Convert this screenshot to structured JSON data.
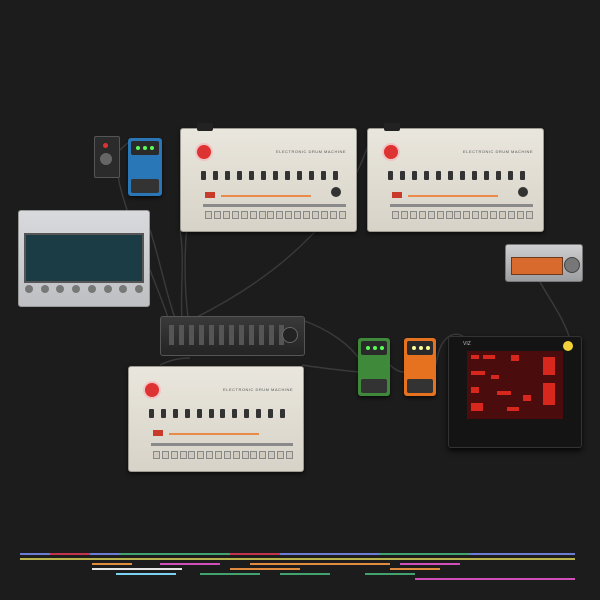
{
  "devices": {
    "drum_top_left": {
      "model_text": "ELECTRONIC DRUM MACHINE"
    },
    "drum_top_right": {
      "model_text": "ELECTRONIC DRUM MACHINE"
    },
    "drum_bottom": {
      "model_text": "ELECTRONIC DRUM MACHINE"
    },
    "matrix": {
      "label": "VIZ"
    }
  },
  "colors": {
    "background": "#1c1c1c",
    "orange_accent": "#e98b46",
    "red_accent": "#c83a2a",
    "matrix_red": "#d8281e",
    "pedal_green": "#3f8a3a",
    "pedal_orange": "#e6721f",
    "pedal_blue": "#2a77b8",
    "timeline": [
      "#3b5bd1",
      "#c2334e",
      "#41a16f",
      "#e08b3d",
      "#d14fb9",
      "#7bd1f0",
      "#e5e5e5",
      "#b8b34c"
    ]
  },
  "icons": {
    "drum_logo": "heart-logo-icon",
    "knob": "knob-icon"
  }
}
